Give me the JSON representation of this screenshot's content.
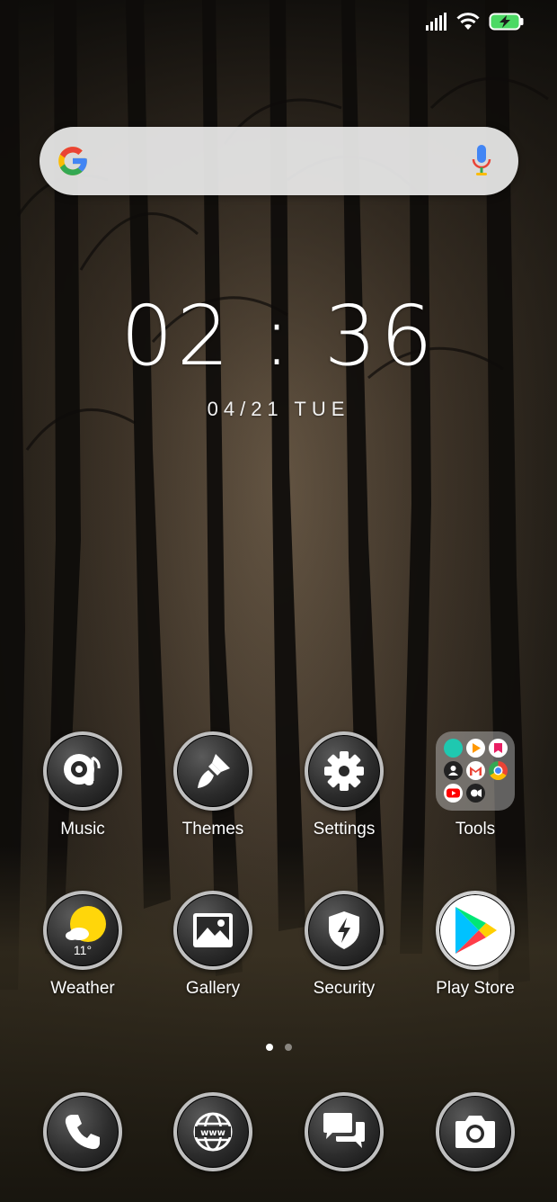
{
  "status_bar": {
    "signal_icon": "signal-icon",
    "wifi_icon": "wifi-icon",
    "battery_icon": "battery-charging-icon"
  },
  "search": {
    "logo_icon": "google-g-icon",
    "mic_icon": "mic-icon"
  },
  "clock": {
    "time": "02 : 36",
    "date": "04/21 TUE"
  },
  "apps_row1": [
    {
      "label": "Music",
      "icon": "music-icon"
    },
    {
      "label": "Themes",
      "icon": "brush-icon"
    },
    {
      "label": "Settings",
      "icon": "gear-icon"
    },
    {
      "label": "Tools",
      "icon": "folder-icon"
    }
  ],
  "apps_row2": [
    {
      "label": "Weather",
      "icon": "weather-icon",
      "temperature": "11°"
    },
    {
      "label": "Gallery",
      "icon": "gallery-icon"
    },
    {
      "label": "Security",
      "icon": "shield-icon"
    },
    {
      "label": "Play Store",
      "icon": "play-store-icon"
    }
  ],
  "dock": [
    {
      "icon": "phone-icon"
    },
    {
      "icon": "browser-icon",
      "text": "www"
    },
    {
      "icon": "messages-icon"
    },
    {
      "icon": "camera-icon"
    }
  ],
  "page_indicator": {
    "pages": 2,
    "current": 1
  },
  "colors": {
    "battery": "#4cd964",
    "google_blue": "#4285f4",
    "google_red": "#ea4335",
    "google_yellow": "#fbbc05",
    "google_green": "#34a853",
    "weather_sun": "#ffd60a"
  }
}
